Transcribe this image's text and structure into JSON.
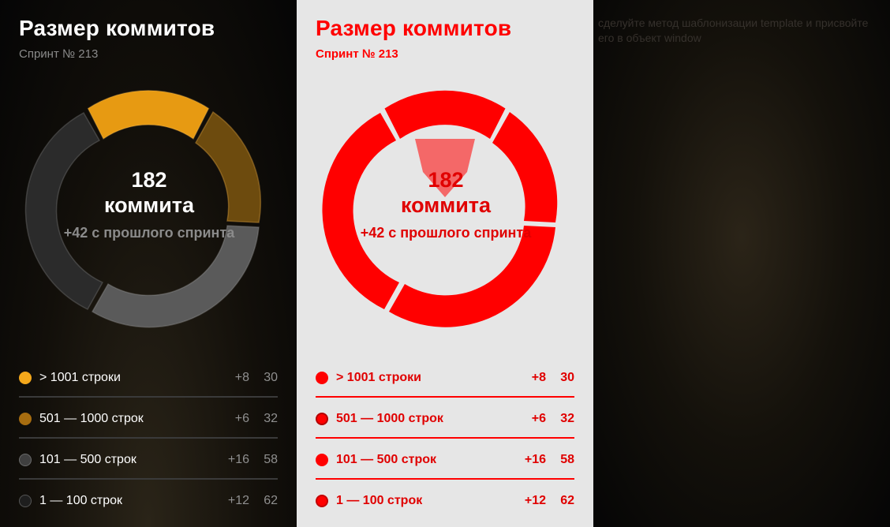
{
  "card": {
    "title": "Размер коммитов",
    "subtitle": "Спринт № 213",
    "center_count": "182",
    "center_unit": "коммита",
    "center_delta": "+42 с прошлого спринта"
  },
  "legend": [
    {
      "label": "> 1001 строки",
      "diff": "+8",
      "value": "30"
    },
    {
      "label": "501 — 1000 строк",
      "diff": "+6",
      "value": "32"
    },
    {
      "label": "101 — 500 строк",
      "diff": "+16",
      "value": "58"
    },
    {
      "label": "1 — 100 строк",
      "diff": "+12",
      "value": "62"
    }
  ],
  "hint_text": "сделуйте метод шаблонизации template и присвойте его в объект window",
  "colors": {
    "gold": "#f4a81b",
    "gold_dark": "#7a5410",
    "gray_light": "#8c8c8c",
    "gray_dark": "#3b3b3b",
    "light_accent": "#ff0000"
  },
  "icons": {
    "legend_dot": "circle"
  }
}
